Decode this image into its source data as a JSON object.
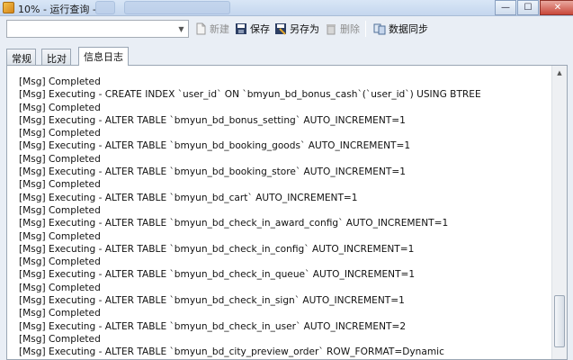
{
  "window": {
    "title": "10% - 运行查询 -",
    "controls": {
      "minimize": "—",
      "maximize": "☐",
      "close": "✕"
    }
  },
  "toolbar": {
    "query_combo_value": "",
    "items": [
      {
        "label": "新建",
        "icon": "new-file-icon",
        "disabled": true
      },
      {
        "label": "保存",
        "icon": "save-icon",
        "disabled": false
      },
      {
        "label": "另存为",
        "icon": "save-as-icon",
        "disabled": false
      },
      {
        "label": "删除",
        "icon": "delete-icon",
        "disabled": true
      },
      {
        "label": "数据同步",
        "icon": "data-sync-icon",
        "disabled": false
      }
    ]
  },
  "tabs": [
    {
      "label": "常规",
      "active": false
    },
    {
      "label": "比对",
      "active": false
    },
    {
      "label": "信息日志",
      "active": true
    }
  ],
  "log_lines": [
    "[Msg] Completed",
    "[Msg] Executing - CREATE INDEX `user_id` ON `bmyun_bd_bonus_cash`(`user_id`) USING BTREE",
    "[Msg] Completed",
    "[Msg] Executing - ALTER TABLE `bmyun_bd_bonus_setting` AUTO_INCREMENT=1",
    "[Msg] Completed",
    "[Msg] Executing - ALTER TABLE `bmyun_bd_booking_goods` AUTO_INCREMENT=1",
    "[Msg] Completed",
    "[Msg] Executing - ALTER TABLE `bmyun_bd_booking_store` AUTO_INCREMENT=1",
    "[Msg] Completed",
    "[Msg] Executing - ALTER TABLE `bmyun_bd_cart` AUTO_INCREMENT=1",
    "[Msg] Completed",
    "[Msg] Executing - ALTER TABLE `bmyun_bd_check_in_award_config` AUTO_INCREMENT=1",
    "[Msg] Completed",
    "[Msg] Executing - ALTER TABLE `bmyun_bd_check_in_config` AUTO_INCREMENT=1",
    "[Msg] Completed",
    "[Msg] Executing - ALTER TABLE `bmyun_bd_check_in_queue` AUTO_INCREMENT=1",
    "[Msg] Completed",
    "[Msg] Executing - ALTER TABLE `bmyun_bd_check_in_sign` AUTO_INCREMENT=1",
    "[Msg] Completed",
    "[Msg] Executing - ALTER TABLE `bmyun_bd_check_in_user` AUTO_INCREMENT=2",
    "[Msg] Completed",
    "[Msg] Executing - ALTER TABLE `bmyun_bd_city_preview_order` ROW_FORMAT=Dynamic"
  ],
  "scrollbar": {
    "position_fraction": 0.95
  }
}
